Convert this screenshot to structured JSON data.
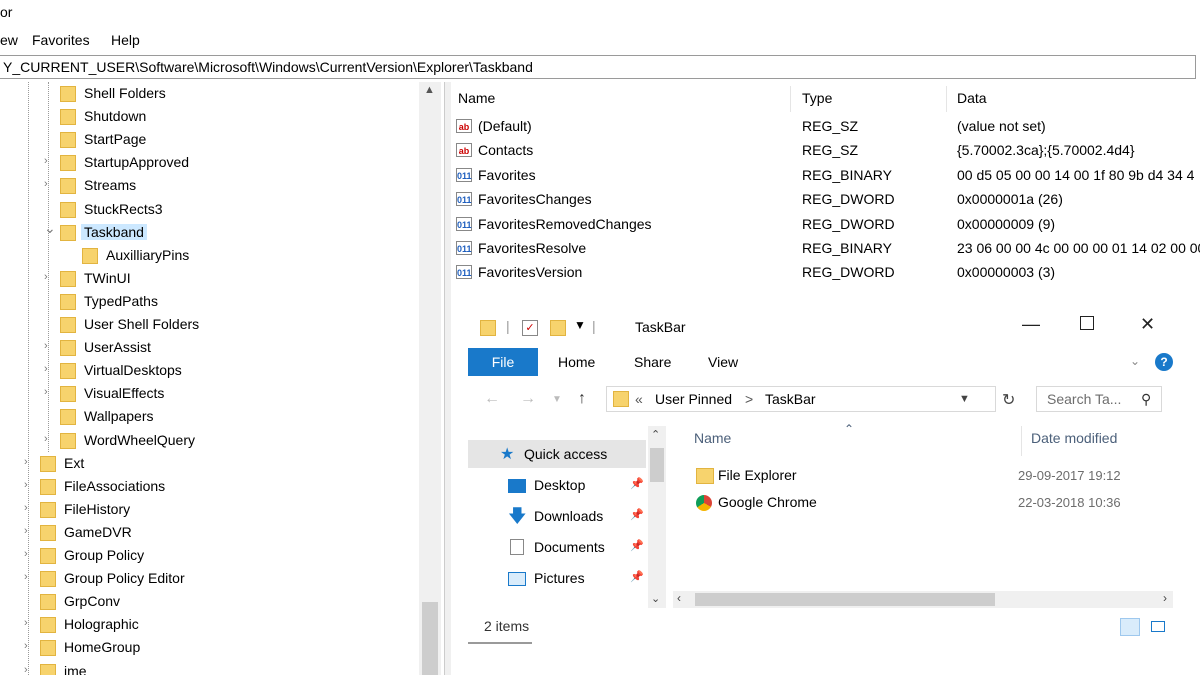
{
  "window": {
    "title": "or"
  },
  "menu": {
    "view": "ew",
    "favorites": "Favorites",
    "help": "Help"
  },
  "address": "Y_CURRENT_USER\\Software\\Microsoft\\Windows\\CurrentVersion\\Explorer\\Taskband",
  "tree": {
    "items": [
      {
        "label": "Shell Folders",
        "expandable": false
      },
      {
        "label": "Shutdown",
        "expandable": false
      },
      {
        "label": "StartPage",
        "expandable": false
      },
      {
        "label": "StartupApproved",
        "expandable": true
      },
      {
        "label": "Streams",
        "expandable": true
      },
      {
        "label": "StuckRects3",
        "expandable": false
      },
      {
        "label": "Taskband",
        "expandable": true,
        "selected": true
      },
      {
        "label": "AuxilliaryPins",
        "expandable": false
      },
      {
        "label": "TWinUI",
        "expandable": true
      },
      {
        "label": "TypedPaths",
        "expandable": false
      },
      {
        "label": "User Shell Folders",
        "expandable": false
      },
      {
        "label": "UserAssist",
        "expandable": true
      },
      {
        "label": "VirtualDesktops",
        "expandable": true
      },
      {
        "label": "VisualEffects",
        "expandable": true
      },
      {
        "label": "Wallpapers",
        "expandable": false
      },
      {
        "label": "WordWheelQuery",
        "expandable": true
      },
      {
        "label": "Ext",
        "expandable": true
      },
      {
        "label": "FileAssociations",
        "expandable": true
      },
      {
        "label": "FileHistory",
        "expandable": true
      },
      {
        "label": "GameDVR",
        "expandable": true
      },
      {
        "label": "Group Policy",
        "expandable": true
      },
      {
        "label": "Group Policy Editor",
        "expandable": true
      },
      {
        "label": "GrpConv",
        "expandable": false
      },
      {
        "label": "Holographic",
        "expandable": true
      },
      {
        "label": "HomeGroup",
        "expandable": true
      },
      {
        "label": "ime",
        "expandable": true
      }
    ]
  },
  "values": {
    "headers": {
      "name": "Name",
      "type": "Type",
      "data": "Data"
    },
    "rows": [
      {
        "icon": "string-value-icon",
        "name": "(Default)",
        "type": "REG_SZ",
        "data": "(value not set)"
      },
      {
        "icon": "string-value-icon",
        "name": "Contacts",
        "type": "REG_SZ",
        "data": "{5.70002.3ca};{5.70002.4d4}"
      },
      {
        "icon": "binary-value-icon",
        "name": "Favorites",
        "type": "REG_BINARY",
        "data": "00 d5 05 00 00 14 00 1f 80 9b d4 34 4"
      },
      {
        "icon": "binary-value-icon",
        "name": "FavoritesChanges",
        "type": "REG_DWORD",
        "data": "0x0000001a (26)"
      },
      {
        "icon": "binary-value-icon",
        "name": "FavoritesRemovedChanges",
        "type": "REG_DWORD",
        "data": "0x00000009 (9)"
      },
      {
        "icon": "binary-value-icon",
        "name": "FavoritesResolve",
        "type": "REG_BINARY",
        "data": "23 06 00 00 4c 00 00 00 01 14 02 00 00"
      },
      {
        "icon": "binary-value-icon",
        "name": "FavoritesVersion",
        "type": "REG_DWORD",
        "data": "0x00000003 (3)"
      }
    ]
  },
  "explorer": {
    "title": "TaskBar",
    "qat_sep": "|",
    "ribbon": {
      "file": "File",
      "home": "Home",
      "share": "Share",
      "view": "View"
    },
    "help_glyph": "?",
    "path": {
      "prefix": "«",
      "crumb1": "User Pinned",
      "sep": ">",
      "crumb2": "TaskBar"
    },
    "search_placeholder": "Search Ta...",
    "nav": [
      {
        "label": "Quick access",
        "pinned": false
      },
      {
        "label": "Desktop",
        "pinned": true
      },
      {
        "label": "Downloads",
        "pinned": true
      },
      {
        "label": "Documents",
        "pinned": true
      },
      {
        "label": "Pictures",
        "pinned": true
      }
    ],
    "columns": {
      "name": "Name",
      "date": "Date modified"
    },
    "files": [
      {
        "name": "File Explorer",
        "date": "29-09-2017 19:12"
      },
      {
        "name": "Google Chrome",
        "date": "22-03-2018 10:36"
      }
    ],
    "status": "2 items"
  },
  "colors": {
    "accent": "#1979ca",
    "folder": "#f7d36d",
    "selection": "#cce8ff"
  }
}
